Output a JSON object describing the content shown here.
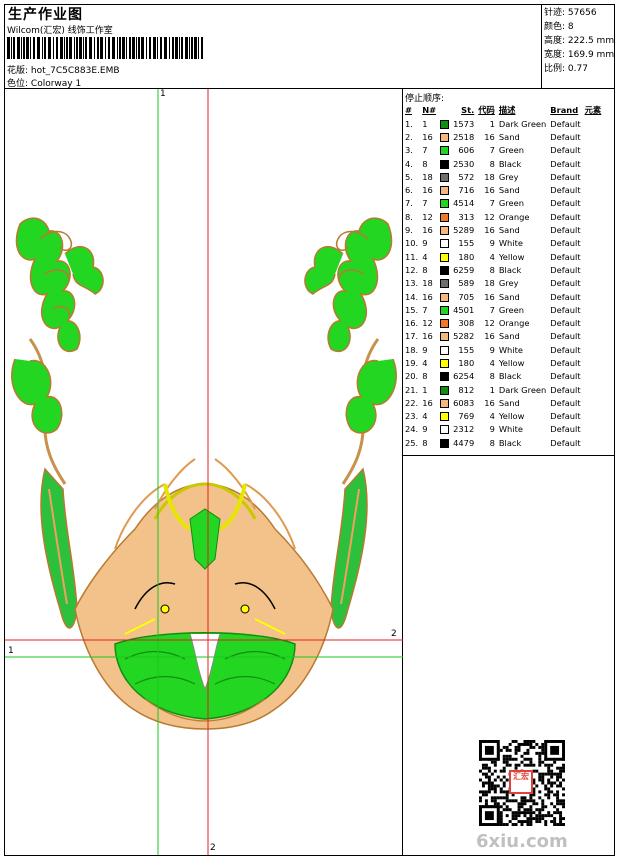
{
  "header": {
    "title": "生产作业图",
    "subtitle": "Wilcom(汇宏) 线饰工作室",
    "design_label": "花版:",
    "design_file": "hot_7C5C883E.EMB",
    "colorway_label": "色位:",
    "colorway": "Colorway 1"
  },
  "stats": [
    {
      "label": "针迹:",
      "value": "57656"
    },
    {
      "label": "颜色:",
      "value": "8"
    },
    {
      "label": "高度:",
      "value": "222.5 mm"
    },
    {
      "label": "宽度:",
      "value": "169.9 mm"
    },
    {
      "label": "比例:",
      "value": "0.77"
    }
  ],
  "stop_sequence_title": "停止顺序:",
  "table_headers": [
    "#",
    "N#",
    "St.",
    "代码",
    "描述",
    "Brand",
    "元素"
  ],
  "colors": {
    "Dark Green": "#128c12",
    "Sand": "#f2b880",
    "Green": "#22d622",
    "Black": "#000000",
    "Grey": "#6e6e6e",
    "Orange": "#f07828",
    "White": "#ffffff",
    "Yellow": "#ffff00"
  },
  "stops": [
    {
      "idx": "1.",
      "n": "1",
      "st": "1573",
      "code": "1",
      "desc": "Dark Green",
      "brand": "Default"
    },
    {
      "idx": "2.",
      "n": "16",
      "st": "2518",
      "code": "16",
      "desc": "Sand",
      "brand": "Default"
    },
    {
      "idx": "3.",
      "n": "7",
      "st": "606",
      "code": "7",
      "desc": "Green",
      "brand": "Default"
    },
    {
      "idx": "4.",
      "n": "8",
      "st": "2530",
      "code": "8",
      "desc": "Black",
      "brand": "Default"
    },
    {
      "idx": "5.",
      "n": "18",
      "st": "572",
      "code": "18",
      "desc": "Grey",
      "brand": "Default"
    },
    {
      "idx": "6.",
      "n": "16",
      "st": "716",
      "code": "16",
      "desc": "Sand",
      "brand": "Default"
    },
    {
      "idx": "7.",
      "n": "7",
      "st": "4514",
      "code": "7",
      "desc": "Green",
      "brand": "Default"
    },
    {
      "idx": "8.",
      "n": "12",
      "st": "313",
      "code": "12",
      "desc": "Orange",
      "brand": "Default"
    },
    {
      "idx": "9.",
      "n": "16",
      "st": "5289",
      "code": "16",
      "desc": "Sand",
      "brand": "Default"
    },
    {
      "idx": "10.",
      "n": "9",
      "st": "155",
      "code": "9",
      "desc": "White",
      "brand": "Default"
    },
    {
      "idx": "11.",
      "n": "4",
      "st": "180",
      "code": "4",
      "desc": "Yellow",
      "brand": "Default"
    },
    {
      "idx": "12.",
      "n": "8",
      "st": "6259",
      "code": "8",
      "desc": "Black",
      "brand": "Default"
    },
    {
      "idx": "13.",
      "n": "18",
      "st": "589",
      "code": "18",
      "desc": "Grey",
      "brand": "Default"
    },
    {
      "idx": "14.",
      "n": "16",
      "st": "705",
      "code": "16",
      "desc": "Sand",
      "brand": "Default"
    },
    {
      "idx": "15.",
      "n": "7",
      "st": "4501",
      "code": "7",
      "desc": "Green",
      "brand": "Default"
    },
    {
      "idx": "16.",
      "n": "12",
      "st": "308",
      "code": "12",
      "desc": "Orange",
      "brand": "Default"
    },
    {
      "idx": "17.",
      "n": "16",
      "st": "5282",
      "code": "16",
      "desc": "Sand",
      "brand": "Default"
    },
    {
      "idx": "18.",
      "n": "9",
      "st": "155",
      "code": "9",
      "desc": "White",
      "brand": "Default"
    },
    {
      "idx": "19.",
      "n": "4",
      "st": "180",
      "code": "4",
      "desc": "Yellow",
      "brand": "Default"
    },
    {
      "idx": "20.",
      "n": "8",
      "st": "6254",
      "code": "8",
      "desc": "Black",
      "brand": "Default"
    },
    {
      "idx": "21.",
      "n": "1",
      "st": "812",
      "code": "1",
      "desc": "Dark Green",
      "brand": "Default"
    },
    {
      "idx": "22.",
      "n": "16",
      "st": "6083",
      "code": "16",
      "desc": "Sand",
      "brand": "Default"
    },
    {
      "idx": "23.",
      "n": "4",
      "st": "769",
      "code": "4",
      "desc": "Yellow",
      "brand": "Default"
    },
    {
      "idx": "24.",
      "n": "9",
      "st": "2312",
      "code": "9",
      "desc": "White",
      "brand": "Default"
    },
    {
      "idx": "25.",
      "n": "8",
      "st": "4479",
      "code": "8",
      "desc": "Black",
      "brand": "Default"
    }
  ],
  "guides": {
    "v1": "1",
    "h2": "2",
    "h1": "1",
    "v2": "2"
  },
  "stamp_text": "汇宏",
  "watermark": "6xiu.com",
  "guide_colors": {
    "green": "#1fc71f",
    "red": "#e02020"
  }
}
